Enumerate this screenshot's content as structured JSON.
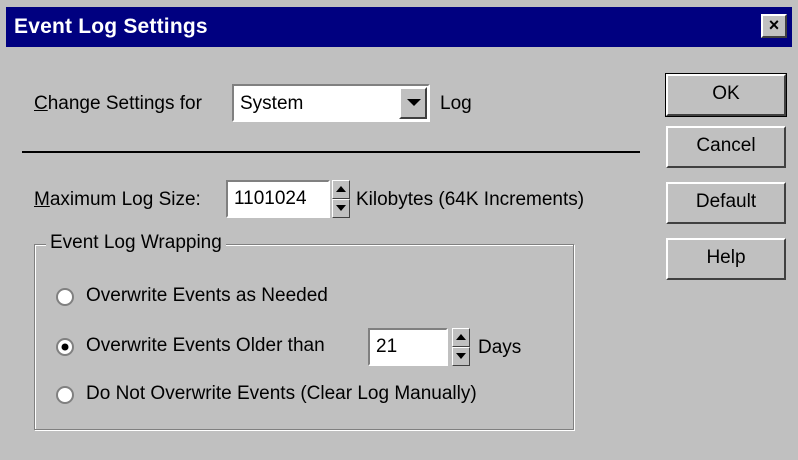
{
  "window": {
    "title": "Event Log Settings",
    "close_glyph": "×"
  },
  "change_settings": {
    "label_prefix": "C",
    "label_rest": "hange Settings for",
    "selected": "System",
    "suffix": "Log"
  },
  "max_log": {
    "label_prefix": "M",
    "label_rest": "aximum Log Size:",
    "value": "1101024",
    "units": "Kilobytes  (64K Increments)"
  },
  "wrapping": {
    "title": "Event Log Wrapping",
    "option1": "Overwrite Events as Needed",
    "option2": "Overwrite Events Older than",
    "days_value": "21",
    "days_label": "Days",
    "option3": "Do Not Overwrite Events (Clear Log Manually)",
    "selected_option": 2
  },
  "buttons": {
    "ok": "OK",
    "cancel": "Cancel",
    "default": "Default",
    "help": "Help"
  },
  "colors": {
    "titlebar": "#000080",
    "face": "#c0c0c0"
  }
}
